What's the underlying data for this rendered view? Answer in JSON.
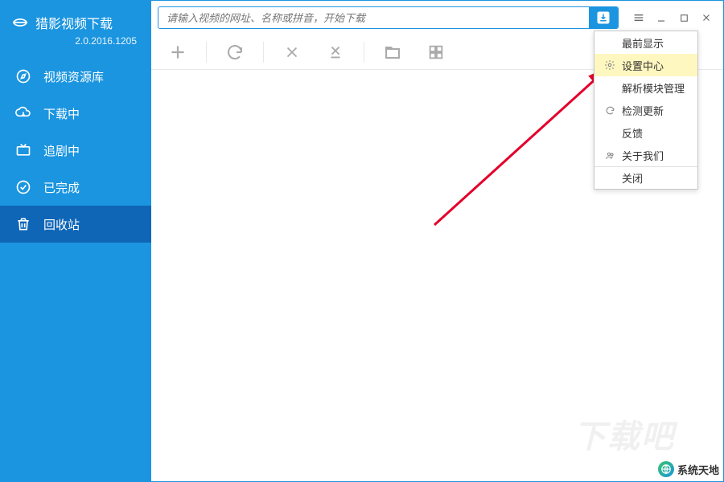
{
  "brand": {
    "title": "猎影视频下载",
    "version": "2.0.2016.1205"
  },
  "sidebar": {
    "items": [
      {
        "label": "视频资源库"
      },
      {
        "label": "下载中"
      },
      {
        "label": "追剧中"
      },
      {
        "label": "已完成"
      },
      {
        "label": "回收站"
      }
    ]
  },
  "search": {
    "placeholder": "请输入视频的网址、名称或拼音，开始下载"
  },
  "menu": {
    "items": [
      {
        "label": "最前显示"
      },
      {
        "label": "设置中心"
      },
      {
        "label": "解析模块管理"
      },
      {
        "label": "检测更新"
      },
      {
        "label": "反馈"
      },
      {
        "label": "关于我们"
      },
      {
        "label": "关闭"
      }
    ]
  },
  "watermark": "下载吧",
  "corner": "系统天地"
}
